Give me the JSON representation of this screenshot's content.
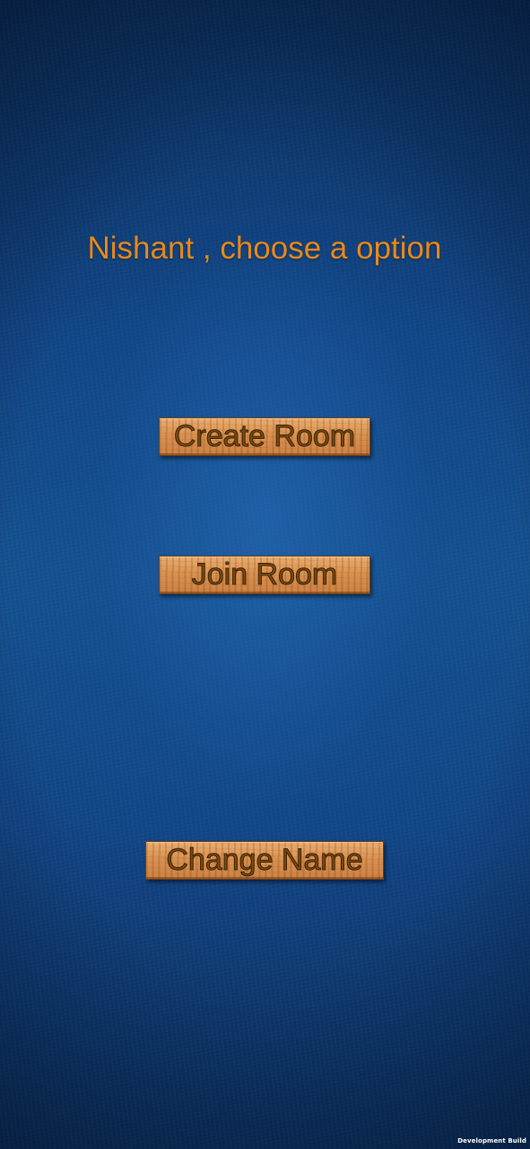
{
  "screen": {
    "title_text": "Nishant , choose a option"
  },
  "buttons": {
    "create_room": "Create Room",
    "join_room": "Join Room",
    "change_name": "Change Name"
  },
  "footer": {
    "build_label": "Development Build"
  },
  "colors": {
    "background": "#0f4384",
    "title": "#e8891c",
    "button_wood": "#d58c4b",
    "button_text": "#7a4a12"
  }
}
